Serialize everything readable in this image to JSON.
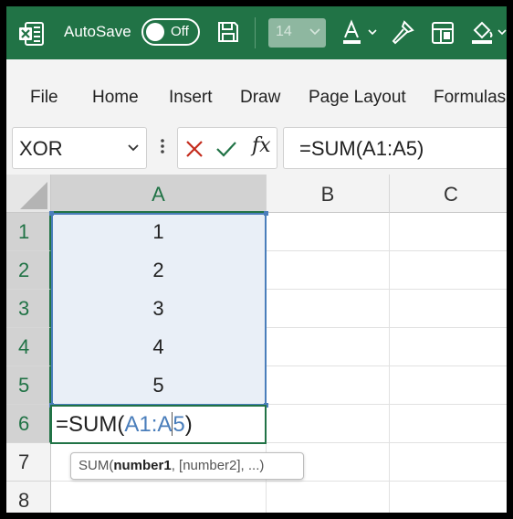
{
  "titlebar": {
    "autosave_label": "AutoSave",
    "autosave_state": "Off",
    "font_size": "14",
    "brand_color": "#217346"
  },
  "ribbon": {
    "tabs": [
      {
        "label": "File"
      },
      {
        "label": "Home"
      },
      {
        "label": "Insert"
      },
      {
        "label": "Draw"
      },
      {
        "label": "Page Layout"
      },
      {
        "label": "Formulas"
      }
    ]
  },
  "formula_bar": {
    "name_box": "XOR",
    "fx_label": "fx",
    "formula": "=SUM(A1:A5)"
  },
  "grid": {
    "columns": [
      "A",
      "B",
      "C"
    ],
    "rows": [
      "1",
      "2",
      "3",
      "4",
      "5",
      "6",
      "7",
      "8"
    ],
    "values_a": [
      "1",
      "2",
      "3",
      "4",
      "5"
    ],
    "edit": {
      "prefix": "=SUM(",
      "ref_start": "A1:A",
      "ref_end": "5",
      "suffix": ")"
    },
    "range_color": "#4a7ebb"
  },
  "tooltip": {
    "func": "SUM(",
    "arg_bold": "number1",
    "rest": ", [number2], ...)"
  }
}
